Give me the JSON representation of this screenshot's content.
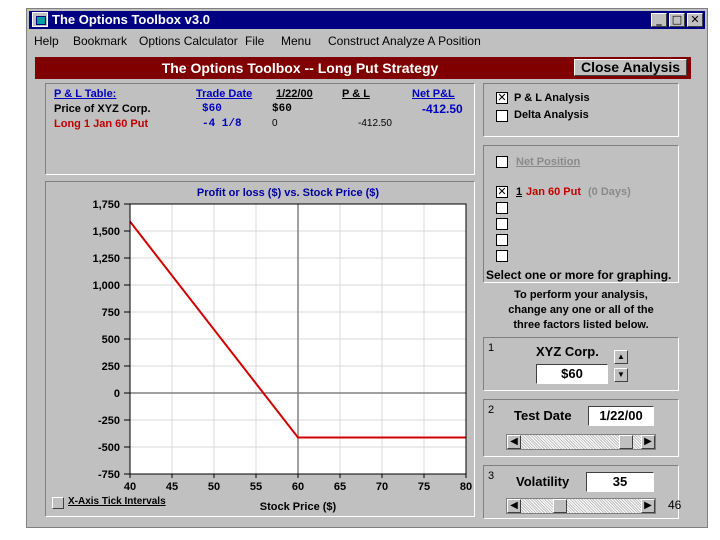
{
  "window": {
    "title": "The Options Toolbox v3.0",
    "min_glyph": "_",
    "max_glyph": "□",
    "close_glyph": "✕"
  },
  "menu": [
    "Help",
    "Bookmark",
    "Options Calculator",
    "File",
    "Menu",
    "Construct Analyze A Position"
  ],
  "header": {
    "title": "The Options Toolbox -- Long Put Strategy",
    "close_label": "Close Analysis"
  },
  "pl_table": {
    "label": "P & L Table:",
    "col_trade_date": "Trade Date",
    "col_date": "1/22/00",
    "col_pl": "P & L",
    "col_net": "Net P&L",
    "net_value": "-412.50",
    "row1": {
      "label": "Price of XYZ Corp.",
      "trade": "$60",
      "date": "$60"
    },
    "row2": {
      "label": "Long 1 Jan 60 Put",
      "trade": "-4  1/8",
      "date": "0",
      "pl": "-412.50"
    }
  },
  "analysis": {
    "pl_label": "P & L Analysis",
    "pl_checked": true,
    "delta_label": "Delta Analysis",
    "delta_checked": false
  },
  "positions": {
    "net_label": "Net Position",
    "item_qty": "1",
    "item_name": "Jan 60 Put",
    "item_days": "(0 Days)",
    "item_checked": true,
    "select_text": "Select one or more for graphing."
  },
  "instructions": [
    "To perform your analysis,",
    "change any one or all of the",
    "three factors listed below."
  ],
  "factor1": {
    "num": "1",
    "label": "XYZ Corp.",
    "value": "$60"
  },
  "factor2": {
    "num": "2",
    "label": "Test Date",
    "value": "1/22/00",
    "thumb_fraction": 0.92
  },
  "factor3": {
    "num": "3",
    "label": "Volatility",
    "value": "35",
    "thumb_fraction": 0.3
  },
  "xaxis_toggle_label": "X-Axis Tick Intervals",
  "page_number": "46",
  "chart_data": {
    "type": "line",
    "title": "Profit or loss ($) vs. Stock Price ($)",
    "xlabel": "Stock Price ($)",
    "ylabel": "",
    "xlim": [
      40,
      80
    ],
    "ylim": [
      -750,
      1750
    ],
    "xticks": [
      40,
      45,
      50,
      55,
      60,
      65,
      70,
      75,
      80
    ],
    "yticks": [
      1750,
      1500,
      1250,
      1000,
      750,
      500,
      250,
      0,
      -250,
      -500,
      -750
    ],
    "ytick_labels": [
      "1,750",
      "1,500",
      "1,250",
      "1,000",
      "750",
      "500",
      "250",
      "0",
      "-250",
      "-500",
      "-750"
    ],
    "grid": true,
    "series": [
      {
        "color": "#d00000",
        "x": [
          40,
          60,
          80
        ],
        "y": [
          1587.5,
          -412.5,
          -412.5
        ]
      }
    ],
    "reference_lines": {
      "x": 60,
      "y": 0
    }
  }
}
